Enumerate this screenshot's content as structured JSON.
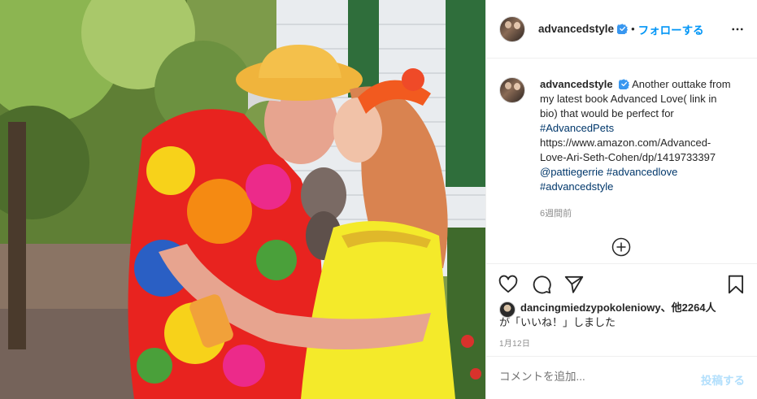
{
  "photo": {
    "icon": "post-photo"
  },
  "header": {
    "username": "advancedstyle",
    "separator": "•",
    "follow_label": "フォローする"
  },
  "caption": {
    "username": "advancedstyle",
    "text_before": "Another outtake from my latest book Advanced Love( link in bio) that would be perfect for",
    "hashtag1": "#AdvancedPets",
    "url": "https://www.amazon.com/Advanced-Love-Ari-Seth-Cohen/dp/1419733397",
    "mention": "@pattiegerrie",
    "hashtag2": "#advancedlove",
    "hashtag3": "#advancedstyle",
    "time_ago": "6週間前"
  },
  "likes": {
    "line1": "dancingmiedzypokoleniowy、他2264人",
    "line2": "が「いいね！」しました"
  },
  "date": "1月12日",
  "comment": {
    "placeholder": "コメントを追加...",
    "post_label": "投稿する"
  },
  "colors": {
    "follow_blue": "#0095f6",
    "verified_blue": "#3897f0",
    "link_blue": "#00376b",
    "muted_gray": "#8e8e8e",
    "post_disabled": "#b2dffc"
  }
}
